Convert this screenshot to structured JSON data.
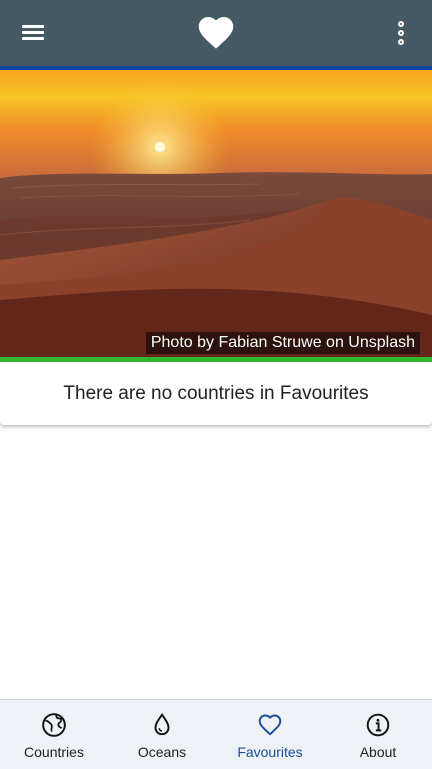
{
  "appbar": {
    "menu_icon": "menu-icon",
    "logo_icon": "heart-icon",
    "more_icon": "more-vert-icon",
    "background": "#455a64",
    "accent_line": "#0d47a1"
  },
  "hero": {
    "credit": "Photo by Fabian Struwe on Unsplash",
    "accent_line": "#2fb72f"
  },
  "favourites": {
    "empty_message": "There are no countries in Favourites"
  },
  "bottom_nav": {
    "active_color": "#1c4e9c",
    "items": [
      {
        "label": "Countries",
        "icon": "globe-icon",
        "active": false
      },
      {
        "label": "Oceans",
        "icon": "water-drop-icon",
        "active": false
      },
      {
        "label": "Favourites",
        "icon": "heart-outline-icon",
        "active": true
      },
      {
        "label": "About",
        "icon": "info-icon",
        "active": false
      }
    ]
  }
}
